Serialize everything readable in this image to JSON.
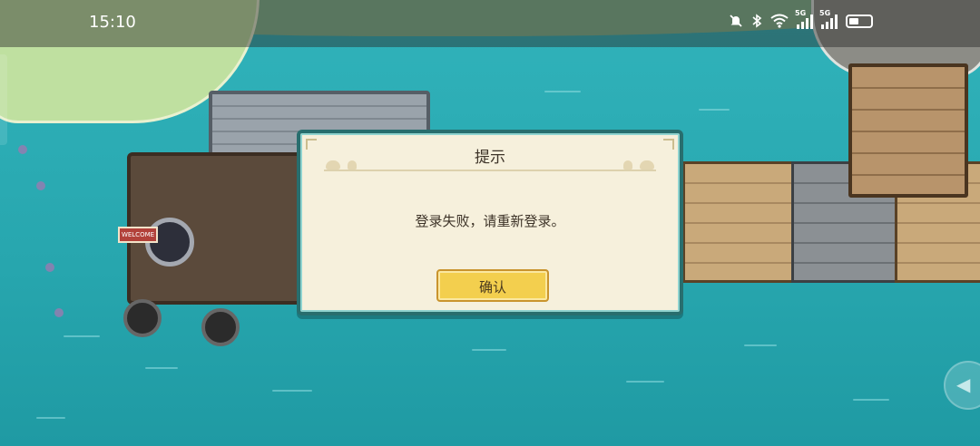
{
  "status_bar": {
    "time": "15:10",
    "icons": [
      "mute-icon",
      "bluetooth-icon",
      "wifi-icon",
      "signal-icon",
      "signal-icon",
      "battery-icon"
    ],
    "signal_label": "5G"
  },
  "dialog": {
    "title": "提示",
    "message": "登录失败，请重新登录。",
    "confirm_label": "确认"
  },
  "scene": {
    "sign_text": "WELCOME"
  },
  "colors": {
    "water": "#2aa8b0",
    "dialog_bg": "#f6f0dc",
    "dialog_border": "#286e6e",
    "button": "#f3cf4e"
  }
}
